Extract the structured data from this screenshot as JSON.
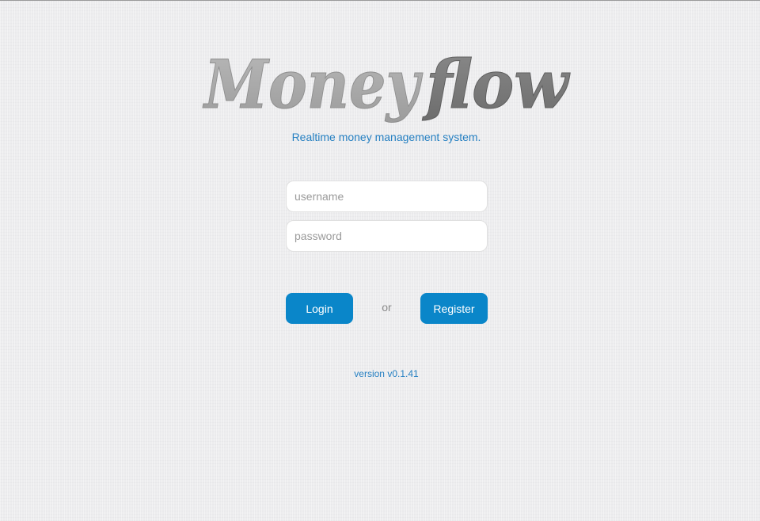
{
  "logo": {
    "part1": "Money",
    "part2": "flow"
  },
  "tagline": "Realtime money management system.",
  "form": {
    "username": {
      "value": "",
      "placeholder": "username"
    },
    "password": {
      "value": "",
      "placeholder": "password"
    }
  },
  "actions": {
    "login_label": "Login",
    "or_label": "or",
    "register_label": "Register"
  },
  "version": "version v0.1.41",
  "colors": {
    "background": "#ececee",
    "accent": "#0a86c9",
    "link_text": "#2680c2",
    "logo_light": "#a8a8a8",
    "logo_dark": "#7a7a7a"
  }
}
